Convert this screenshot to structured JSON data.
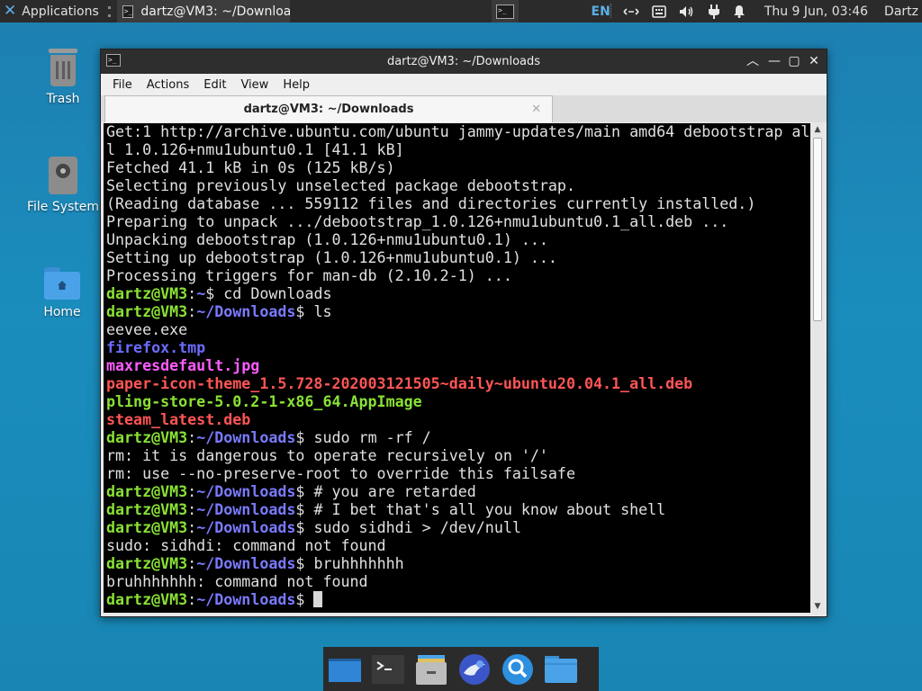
{
  "top_panel": {
    "applications_label": "Applications",
    "task_title": "dartz@VM3: ~/Download…",
    "language": "EN",
    "clock": "Thu  9 Jun, 03:46",
    "user": "Dartz",
    "tray_icons": [
      "network-icon",
      "keyboard-icon",
      "volume-icon",
      "power-icon",
      "notification-bell-icon"
    ]
  },
  "desktop": {
    "icons": [
      {
        "label": "Trash",
        "icon": "trash-icon"
      },
      {
        "label": "File System",
        "icon": "drive-icon"
      },
      {
        "label": "Home",
        "icon": "home-folder-icon"
      }
    ]
  },
  "terminal": {
    "window_title": "dartz@VM3: ~/Downloads",
    "menu": [
      "File",
      "Actions",
      "Edit",
      "View",
      "Help"
    ],
    "tab_title": "dartz@VM3: ~/Downloads",
    "lines": [
      [
        {
          "t": "Get:1 http://archive.ubuntu.com/ubuntu jammy-updates/main amd64 debootstrap al"
        }
      ],
      [
        {
          "t": "l 1.0.126+nmu1ubuntu0.1 [41.1 kB]"
        }
      ],
      [
        {
          "t": "Fetched 41.1 kB in 0s (125 kB/s)"
        }
      ],
      [
        {
          "t": "Selecting previously unselected package debootstrap."
        }
      ],
      [
        {
          "t": "(Reading database ... 559112 files and directories currently installed.)"
        }
      ],
      [
        {
          "t": "Preparing to unpack .../debootstrap_1.0.126+nmu1ubuntu0.1_all.deb ..."
        }
      ],
      [
        {
          "t": "Unpacking debootstrap (1.0.126+nmu1ubuntu0.1) ..."
        }
      ],
      [
        {
          "t": "Setting up debootstrap (1.0.126+nmu1ubuntu0.1) ..."
        }
      ],
      [
        {
          "t": "Processing triggers for man-db (2.10.2-1) ..."
        }
      ],
      [
        {
          "t": "dartz@VM3",
          "c": "u"
        },
        {
          "t": ":"
        },
        {
          "t": "~",
          "c": "p"
        },
        {
          "t": "$ cd Downloads"
        }
      ],
      [
        {
          "t": "dartz@VM3",
          "c": "u"
        },
        {
          "t": ":"
        },
        {
          "t": "~/Downloads",
          "c": "p"
        },
        {
          "t": "$ ls"
        }
      ],
      [
        {
          "t": "eevee.exe"
        }
      ],
      [
        {
          "t": "firefox.tmp",
          "c": "b-blue"
        }
      ],
      [
        {
          "t": "maxresdefault.jpg",
          "c": "b-mag"
        }
      ],
      [
        {
          "t": "paper-icon-theme_1.5.728-202003121505~daily~ubuntu20.04.1_all.deb",
          "c": "b-red"
        }
      ],
      [
        {
          "t": "pling-store-5.0.2-1-x86_64.AppImage",
          "c": "b-grn"
        }
      ],
      [
        {
          "t": "steam_latest.deb",
          "c": "b-red"
        }
      ],
      [
        {
          "t": "dartz@VM3",
          "c": "u"
        },
        {
          "t": ":"
        },
        {
          "t": "~/Downloads",
          "c": "p"
        },
        {
          "t": "$ sudo rm -rf /"
        }
      ],
      [
        {
          "t": "rm: it is dangerous to operate recursively on '/'"
        }
      ],
      [
        {
          "t": "rm: use --no-preserve-root to override this failsafe"
        }
      ],
      [
        {
          "t": "dartz@VM3",
          "c": "u"
        },
        {
          "t": ":"
        },
        {
          "t": "~/Downloads",
          "c": "p"
        },
        {
          "t": "$ # you are retarded"
        }
      ],
      [
        {
          "t": "dartz@VM3",
          "c": "u"
        },
        {
          "t": ":"
        },
        {
          "t": "~/Downloads",
          "c": "p"
        },
        {
          "t": "$ # I bet that's all you know about shell"
        }
      ],
      [
        {
          "t": "dartz@VM3",
          "c": "u"
        },
        {
          "t": ":"
        },
        {
          "t": "~/Downloads",
          "c": "p"
        },
        {
          "t": "$ sudo sidhdi > /dev/null"
        }
      ],
      [
        {
          "t": "sudo: sidhdi: command not found"
        }
      ],
      [
        {
          "t": "dartz@VM3",
          "c": "u"
        },
        {
          "t": ":"
        },
        {
          "t": "~/Downloads",
          "c": "p"
        },
        {
          "t": "$ bruhhhhhhh"
        }
      ],
      [
        {
          "t": "bruhhhhhhh: command not found"
        }
      ],
      [
        {
          "t": "dartz@VM3",
          "c": "u"
        },
        {
          "t": ":"
        },
        {
          "t": "~/Downloads",
          "c": "p"
        },
        {
          "t": "$ "
        },
        {
          "cursor": true
        }
      ]
    ]
  },
  "dock": {
    "items": [
      "show-desktop-icon",
      "terminal-icon",
      "file-manager-icon",
      "web-browser-icon",
      "app-finder-icon",
      "folder-icon"
    ]
  },
  "colors": {
    "prompt_user": "#8ae234",
    "prompt_path": "#7a7aff",
    "accent": "#5ab0e8"
  }
}
